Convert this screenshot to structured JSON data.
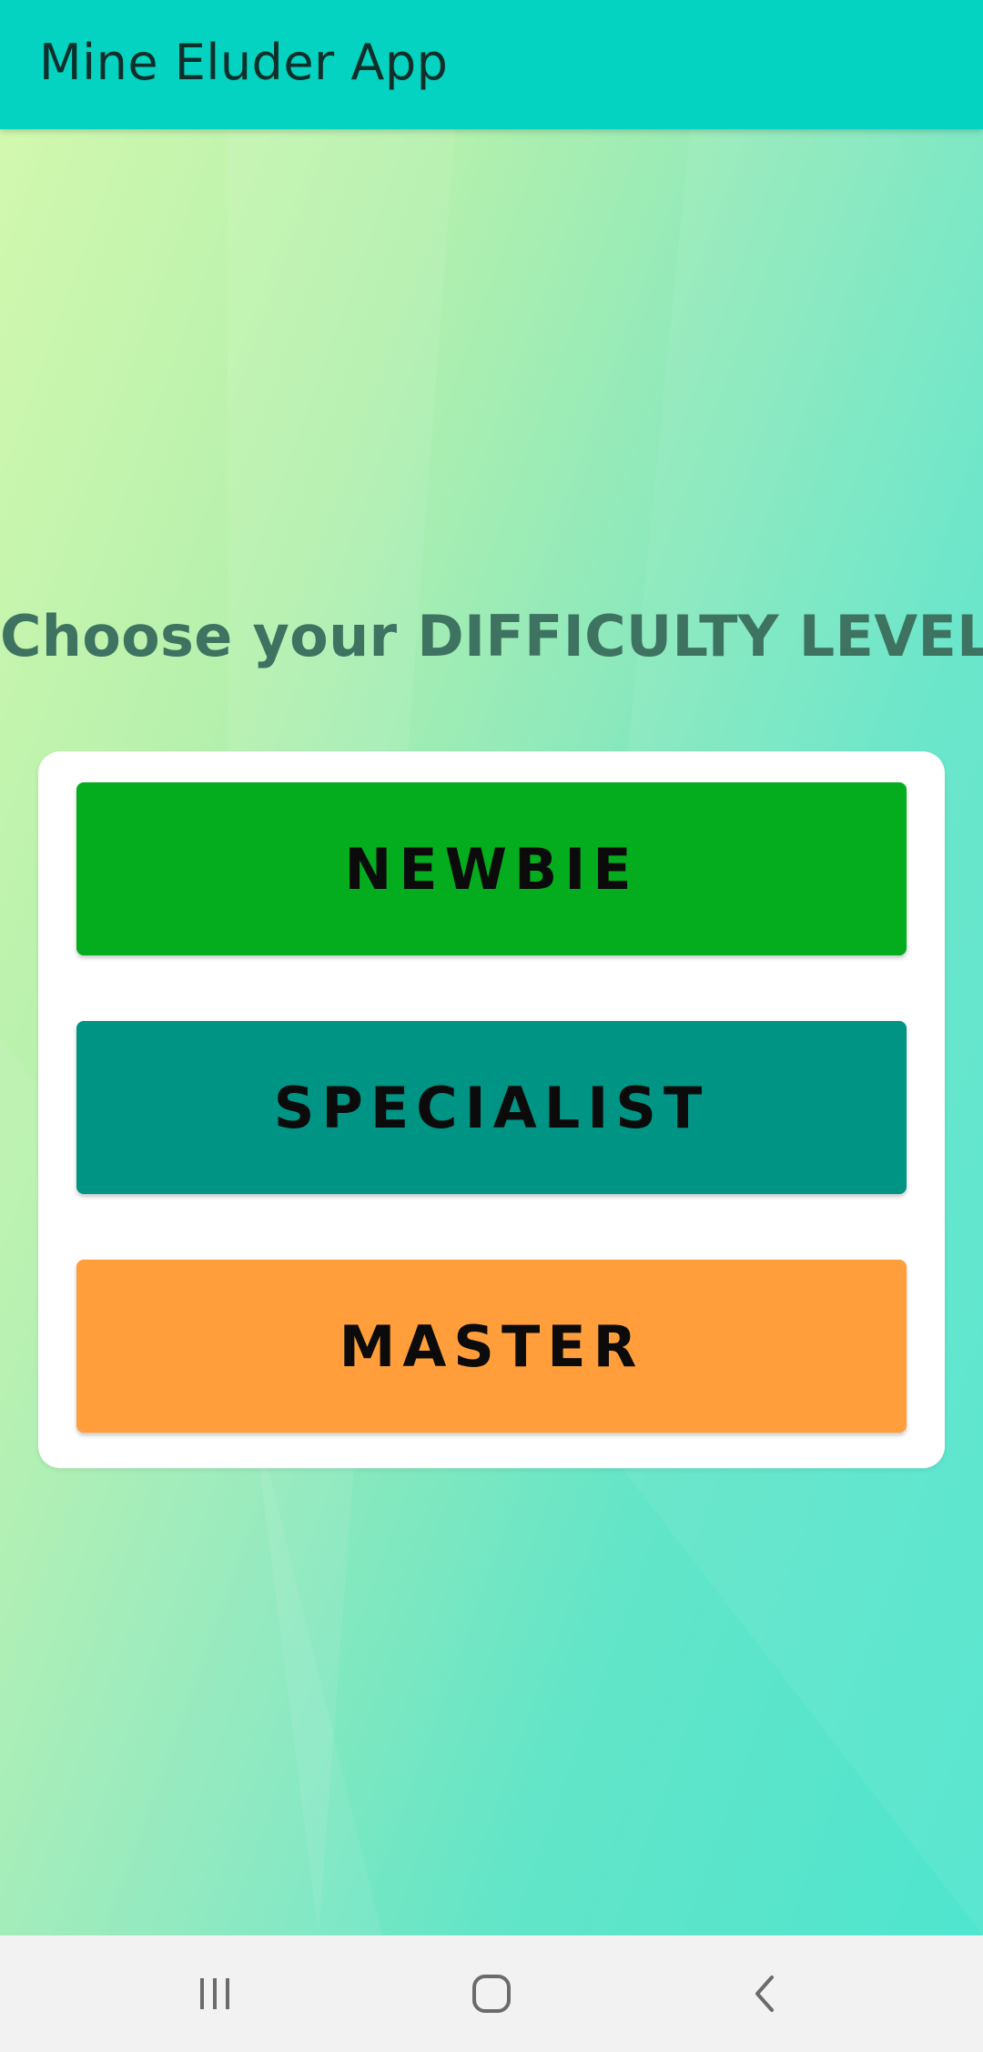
{
  "app_bar": {
    "title": "Mine Eluder App",
    "color": "#03d3c0"
  },
  "main": {
    "headline": "Choose your DIFFICULTY LEVEL",
    "levels": [
      {
        "label": "NEWBIE",
        "color": "#03ad1e"
      },
      {
        "label": "SPECIALIST",
        "color": "#009484"
      },
      {
        "label": "MASTER",
        "color": "#ff9e3a"
      }
    ]
  },
  "nav_bar": {
    "icons": [
      "recents-icon",
      "home-icon",
      "back-icon"
    ]
  }
}
